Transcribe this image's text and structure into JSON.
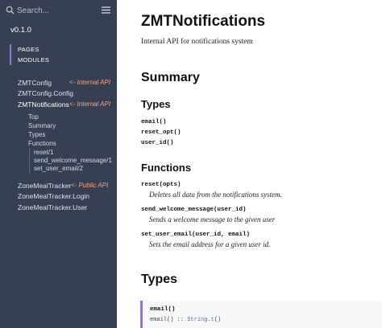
{
  "sidebar": {
    "search": {
      "placeholder": "Search..."
    },
    "version": "v0.1.0",
    "tabs": [
      {
        "label": "PAGES"
      },
      {
        "label": "MODULES"
      }
    ],
    "modules": [
      {
        "label": "ZMTConfig",
        "annotation": "<- Internal API"
      },
      {
        "label": "ZMTConfig.Config"
      },
      {
        "label": "ZMTNotifications",
        "annotation": "<- Internal API"
      },
      {
        "label": "ZoneMealTracker",
        "annotation": "<- Public API"
      },
      {
        "label": "ZoneMealTracker.Login"
      },
      {
        "label": "ZoneMealTracker.User"
      }
    ],
    "sections": [
      {
        "label": "Top"
      },
      {
        "label": "Summary"
      },
      {
        "label": "Types"
      },
      {
        "label": "Functions"
      }
    ],
    "functions": [
      {
        "label": "reset/1"
      },
      {
        "label": "send_welcome_message/1"
      },
      {
        "label": "set_user_email/2"
      }
    ],
    "icons": {
      "search": "search-icon",
      "menu": "hamburger-menu-icon"
    }
  },
  "main": {
    "title": "ZMTNotifications",
    "description": "Internal API for notifications system",
    "summary": {
      "heading": "Summary",
      "types_heading": "Types",
      "types": [
        "email()",
        "reset_opt()",
        "user_id()"
      ],
      "functions_heading": "Functions",
      "functions": [
        {
          "name": "reset(opts)",
          "desc": "Deletes all data from the notifications system."
        },
        {
          "name": "send_welcome_message(user_id)",
          "desc": "Sends a welcome message to the given user"
        },
        {
          "name": "set_user_email(user_id, email)",
          "desc": "Sets the email address for a given user id."
        }
      ]
    },
    "types_section": {
      "heading": "Types",
      "first": {
        "name": "email()",
        "spec_prefix": "email() :: ",
        "spec_type": "String.t",
        "spec_suffix": "()"
      }
    }
  },
  "colors": {
    "sidebar_bg": "#373f52",
    "accent": "#8d79c9",
    "annotation": "#f6a583"
  }
}
